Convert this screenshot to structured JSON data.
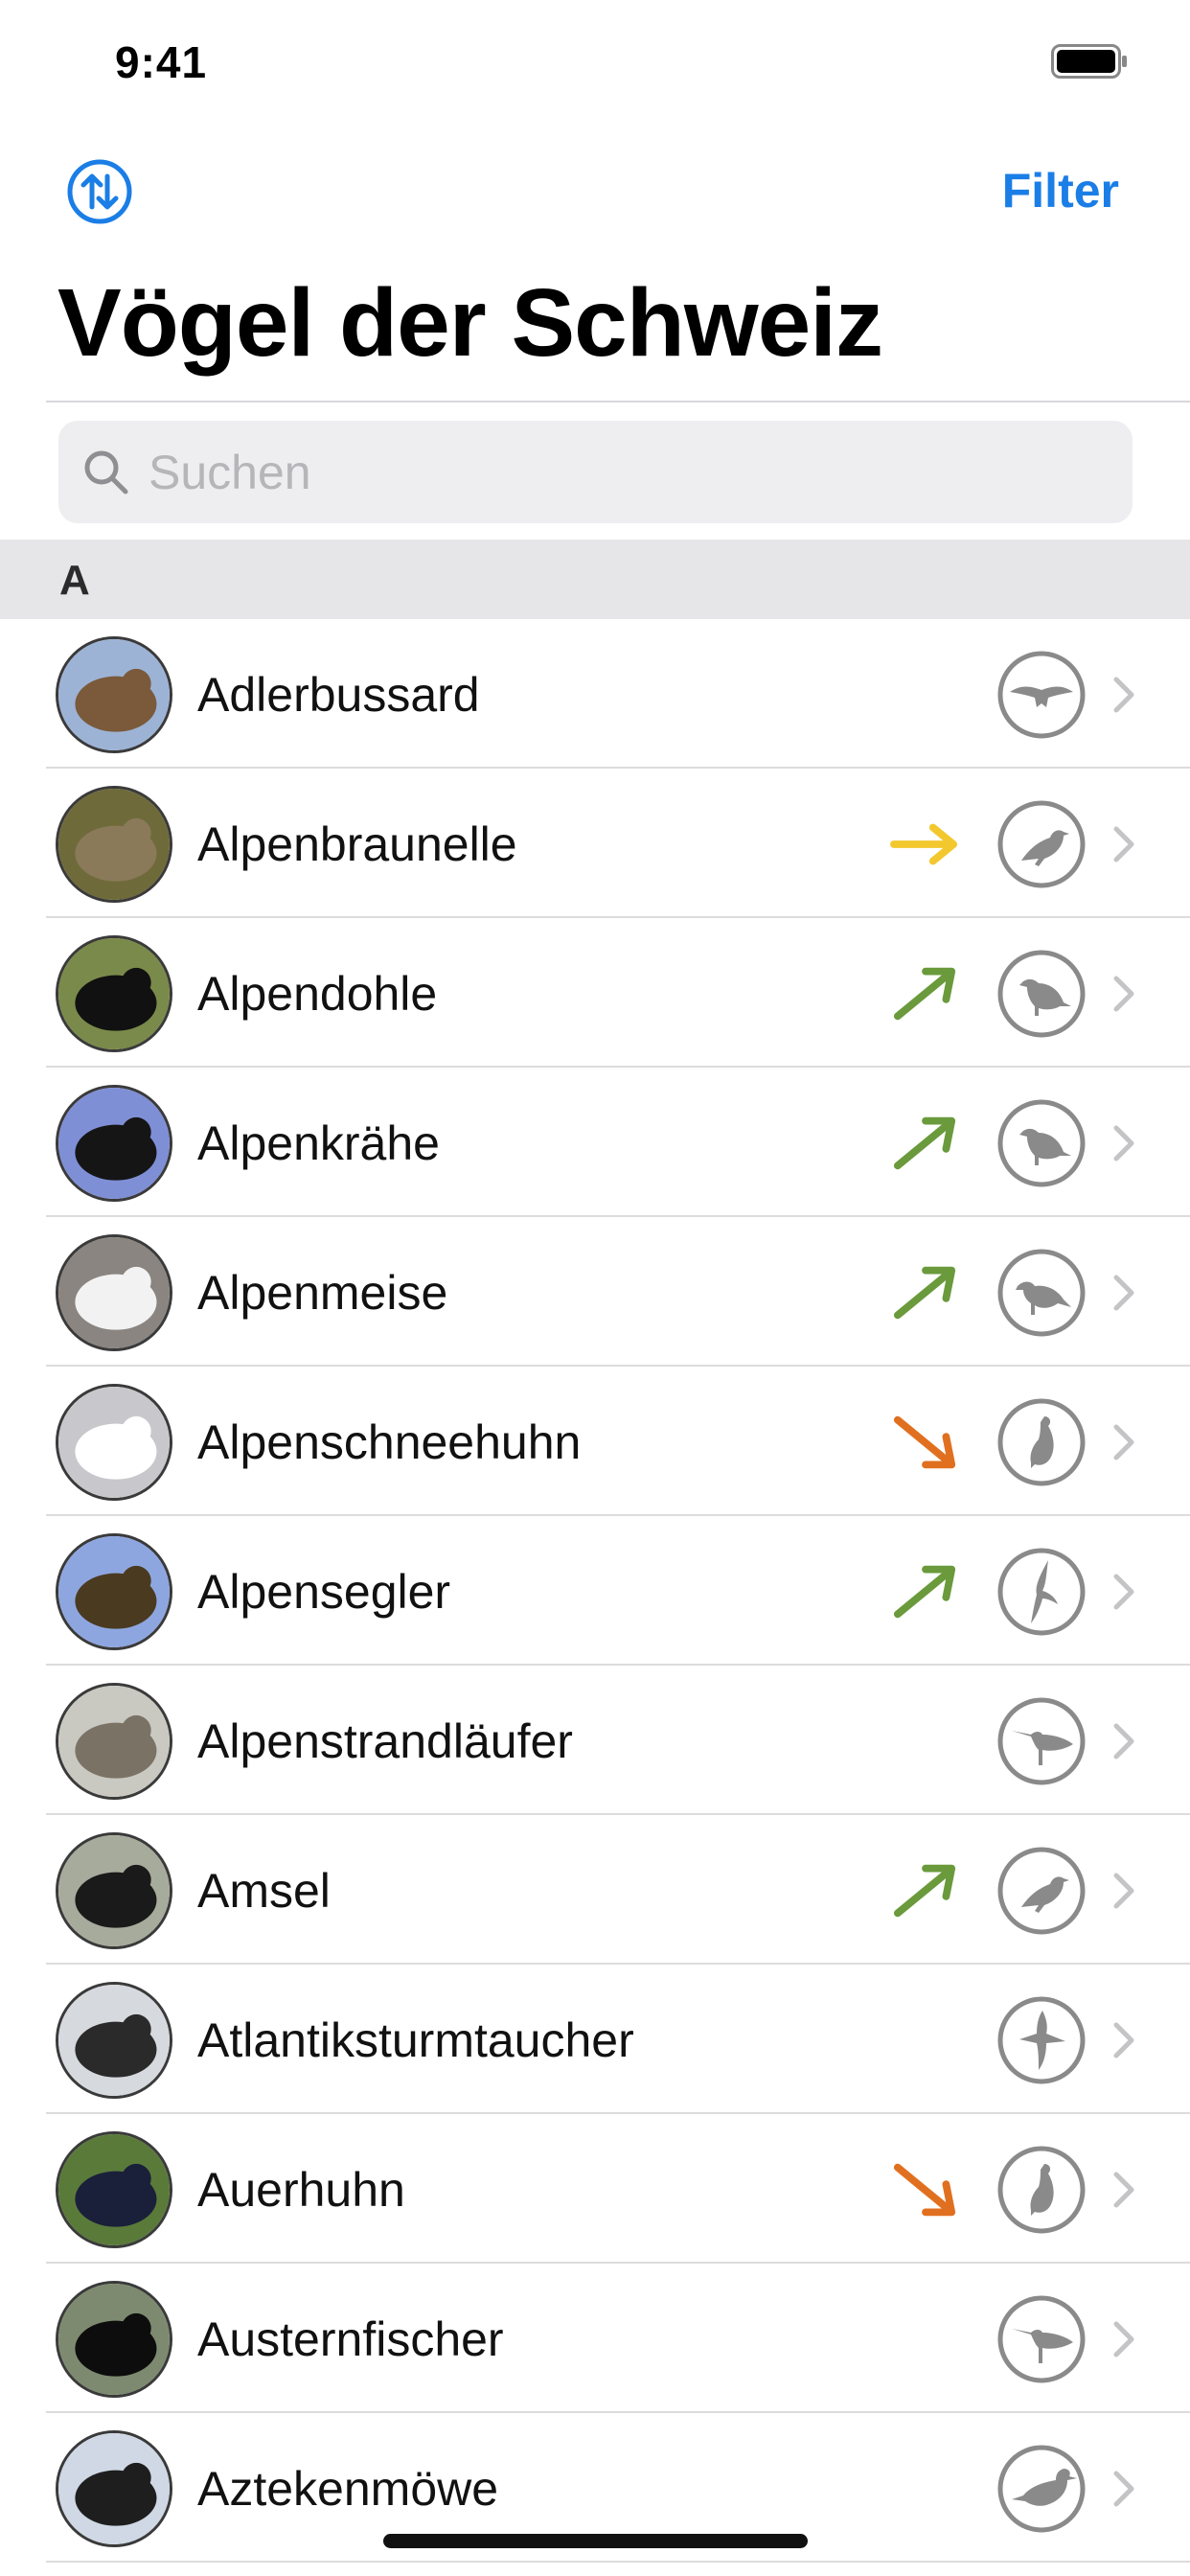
{
  "status_bar": {
    "time": "9:41"
  },
  "nav": {
    "filter_label": "Filter"
  },
  "title": "Vögel der Schweiz",
  "search": {
    "placeholder": "Suchen",
    "value": ""
  },
  "section": {
    "letter": "A"
  },
  "colors": {
    "accent": "#1a7ee6",
    "trend_stable": "#f3c82e",
    "trend_up": "#6a9a3c",
    "trend_down": "#e07020",
    "icon_gray": "#8a8a8a"
  },
  "birds": [
    {
      "name": "Adlerbussard",
      "trend": "none",
      "habit": "raptor-icon",
      "avatar": [
        "#9db3d6",
        "#7a5a3a"
      ]
    },
    {
      "name": "Alpenbraunelle",
      "trend": "stable",
      "habit": "songbird-perched-icon",
      "avatar": [
        "#6f6a3a",
        "#8a7a5a"
      ]
    },
    {
      "name": "Alpendohle",
      "trend": "up",
      "habit": "crow-icon",
      "avatar": [
        "#7a8a4a",
        "#111111"
      ]
    },
    {
      "name": "Alpenkrähe",
      "trend": "up",
      "habit": "crow-icon",
      "avatar": [
        "#7f8fd6",
        "#151515"
      ]
    },
    {
      "name": "Alpenmeise",
      "trend": "up",
      "habit": "songbird-icon",
      "avatar": [
        "#8a8580",
        "#f2f2f2"
      ]
    },
    {
      "name": "Alpenschneehuhn",
      "trend": "down",
      "habit": "upright-bird-icon",
      "avatar": [
        "#c8c8cc",
        "#ffffff"
      ]
    },
    {
      "name": "Alpensegler",
      "trend": "up",
      "habit": "swift-icon",
      "avatar": [
        "#8ea6e0",
        "#4a3a20"
      ]
    },
    {
      "name": "Alpenstrandläufer",
      "trend": "none",
      "habit": "wader-icon",
      "avatar": [
        "#c9c9c2",
        "#7a7265"
      ]
    },
    {
      "name": "Amsel",
      "trend": "up",
      "habit": "songbird-perched-icon",
      "avatar": [
        "#a7ab9c",
        "#1a1a1a"
      ]
    },
    {
      "name": "Atlantiksturmtaucher",
      "trend": "none",
      "habit": "seabird-icon",
      "avatar": [
        "#d6d9de",
        "#2a2a2a"
      ]
    },
    {
      "name": "Auerhuhn",
      "trend": "down",
      "habit": "upright-bird-icon",
      "avatar": [
        "#5a7a3a",
        "#1a1f3a"
      ]
    },
    {
      "name": "Austernfischer",
      "trend": "none",
      "habit": "wader-icon",
      "avatar": [
        "#7d8a70",
        "#0d0d0d"
      ]
    },
    {
      "name": "Aztekenmöwe",
      "trend": "none",
      "habit": "gull-icon",
      "avatar": [
        "#cfd8e4",
        "#1e1e1e"
      ]
    }
  ]
}
